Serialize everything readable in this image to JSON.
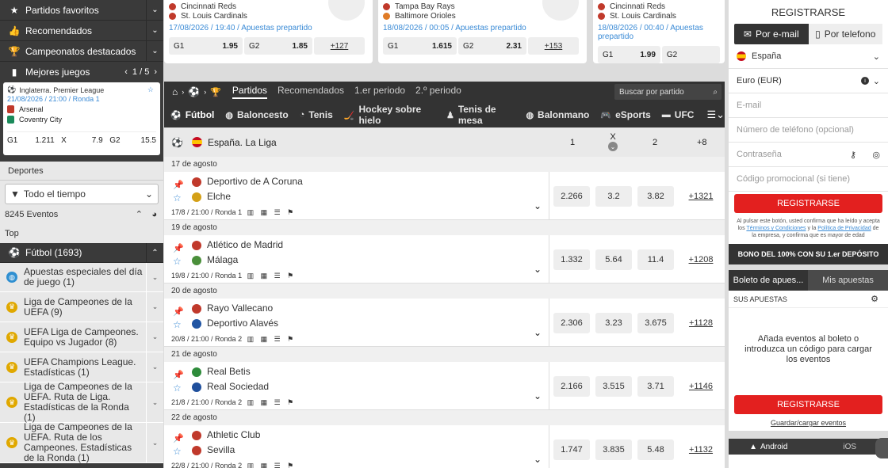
{
  "left": {
    "favoritos": "Partidos favoritos",
    "recomendados": "Recomendados",
    "destacados": "Campeonatos destacados",
    "mejores": "Mejores juegos",
    "mejores_page": "1 / 5",
    "game": {
      "league": "Inglaterra. Premier League",
      "date": "21/08/2026 / 21:00 / Ronda 1",
      "home": "Arsenal",
      "away": "Coventry City",
      "odds": [
        {
          "label": "G1",
          "value": "1.211"
        },
        {
          "label": "X",
          "value": "7.9"
        },
        {
          "label": "G2",
          "value": "15.5"
        }
      ]
    },
    "deportes": "Deportes",
    "filter": "Todo el tiempo",
    "events": "8245 Eventos",
    "top": "Top",
    "futbol": "Fútbol (1693)",
    "items": [
      {
        "label": "Apuestas especiales del día de juego (1)",
        "icon": "globe",
        "color": "#2f8fd1"
      },
      {
        "label": "Liga de Campeones de la UEFA (9)",
        "icon": "ucl",
        "color": "#e0a800"
      },
      {
        "label": "UEFA Liga de Campeones. Equipo vs Jugador (8)",
        "icon": "ucl",
        "color": "#e0a800"
      },
      {
        "label": "UEFA Champions League. Estadísticas (1)",
        "icon": "ucl",
        "color": "#e0a800"
      },
      {
        "label": "Liga de Campeones de la UEFA. Ruta de Liga. Estadísticas de la Ronda (1)",
        "icon": "ucl",
        "color": "#e0a800"
      },
      {
        "label": "Liga de Campeones de la UEFA. Ruta de los Campeones. Estadísticas de la Ronda (1)",
        "icon": "ucl",
        "color": "#e0a800"
      }
    ]
  },
  "top_cards": [
    {
      "home": "Cincinnati Reds",
      "away": "St. Louis Cardinals",
      "date": "17/08/2026 / 19:40 / Apuestas prepartido",
      "o1l": "G1",
      "o1": "1.95",
      "o2l": "G2",
      "o2": "1.85",
      "more": "+127"
    },
    {
      "home": "Tampa Bay Rays",
      "away": "Baltimore Orioles",
      "date": "18/08/2026 / 00:05 / Apuestas prepartido",
      "o1l": "G1",
      "o1": "1.615",
      "o2l": "G2",
      "o2": "2.31",
      "more": "+153"
    },
    {
      "home": "Cincinnati Reds",
      "away": "St. Louis Cardinals",
      "date": "18/08/2026 / 00:40 / Apuestas prepartido",
      "o1l": "G1",
      "o1": "1.99",
      "o2l": "G2",
      "o2": "",
      "more": ""
    }
  ],
  "nav": {
    "tabs": [
      "Partidos",
      "Recomendados",
      "1.er periodo",
      "2.º periodo"
    ],
    "search_placeholder": "Buscar por partido",
    "sports": [
      "Fútbol",
      "Baloncesto",
      "Tenis",
      "Hockey sobre hielo",
      "Tenis de mesa",
      "Balonmano",
      "eSports",
      "UFC"
    ]
  },
  "league": {
    "name": "España. La Liga",
    "c1": "1",
    "cx": "X",
    "c2": "2",
    "cmore": "+8"
  },
  "matches": [
    {
      "date": "17 de agosto",
      "home": "Deportivo de A Coruna",
      "away": "Elche",
      "info": "17/8 / 21:00 / Ronda 1",
      "o1": "2.266",
      "ox": "3.2",
      "o2": "3.82",
      "more": "+1321",
      "hc": "#c0392b",
      "ac": "#d4a017"
    },
    {
      "date": "19 de agosto",
      "home": "Atlético de Madrid",
      "away": "Málaga",
      "info": "19/8 / 21:00 / Ronda 1",
      "o1": "1.332",
      "ox": "5.64",
      "o2": "11.4",
      "more": "+1208",
      "hc": "#c0392b",
      "ac": "#4a8f3a"
    },
    {
      "date": "20 de agosto",
      "home": "Rayo Vallecano",
      "away": "Deportivo Alavés",
      "info": "20/8 / 21:00 / Ronda 2",
      "o1": "2.306",
      "ox": "3.23",
      "o2": "3.675",
      "more": "+1128",
      "hc": "#c0392b",
      "ac": "#2155a3"
    },
    {
      "date": "21 de agosto",
      "home": "Real Betis",
      "away": "Real Sociedad",
      "info": "21/8 / 21:00 / Ronda 2",
      "o1": "2.166",
      "ox": "3.515",
      "o2": "3.71",
      "more": "+1146",
      "hc": "#2e8b3a",
      "ac": "#1f4f9c"
    },
    {
      "date": "22 de agosto",
      "home": "Athletic Club",
      "away": "Sevilla",
      "info": "22/8 / 21:00 / Ronda 2",
      "o1": "1.747",
      "ox": "3.835",
      "o2": "5.48",
      "more": "+1132",
      "hc": "#c0392b",
      "ac": "#c0392b"
    }
  ],
  "right": {
    "title": "REGISTRARSE",
    "tab_email": "Por e-mail",
    "tab_phone": "Por telefono",
    "country": "España",
    "currency": "Euro (EUR)",
    "email": "E-mail",
    "phone": "Número de teléfono (opcional)",
    "password": "Contraseña",
    "promo": "Código promocional (si tiene)",
    "register": "REGISTRARSE",
    "legal1": "Al pulsar este botón, usted confirma que ha leído y acepta los ",
    "terms": "Términos y Condiciones",
    "legal2": " y la ",
    "privacy": "Política de Privacidad",
    "legal3": " de la empresa, y confirma que es mayor de edad",
    "bonus": "BONO DEL 100% CON SU 1.er DEPÓSITO",
    "slip_tab": "Boleto de apues...",
    "my_bets": "Mis apuestas",
    "sus": "SUS APUESTAS",
    "empty": "Añada eventos al boleto o introduzca un código para cargar los eventos",
    "register2": "REGISTRARSE",
    "save": "Guardar/cargar eventos",
    "android": "Android",
    "ios": "iOS"
  }
}
